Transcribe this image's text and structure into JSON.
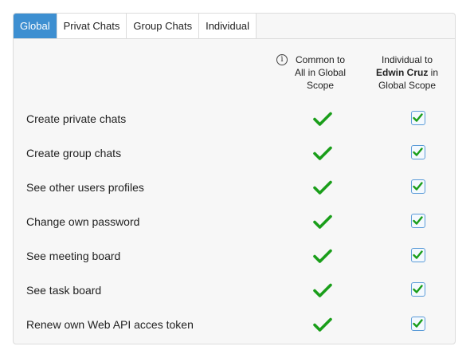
{
  "tabs": [
    {
      "label": "Global",
      "active": true
    },
    {
      "label": "Privat Chats",
      "active": false
    },
    {
      "label": "Group Chats",
      "active": false
    },
    {
      "label": "Individual",
      "active": false
    }
  ],
  "columns": {
    "common_line1": "Common to",
    "common_line2": "All in Global",
    "common_line3": "Scope",
    "indiv_prefix": "Individual to",
    "indiv_user": "Edwin Cruz",
    "indiv_in": "in",
    "indiv_suffix": "Global Scope"
  },
  "info_icon": "info-circle-icon",
  "colors": {
    "accent": "#3d8fd1",
    "check": "#1a9e1a",
    "checkbox_border": "#5a9bd8"
  },
  "permissions": [
    {
      "label": "Create private chats",
      "common": true,
      "individual": true
    },
    {
      "label": "Create group chats",
      "common": true,
      "individual": true
    },
    {
      "label": "See other users profiles",
      "common": true,
      "individual": true
    },
    {
      "label": "Change own password",
      "common": true,
      "individual": true
    },
    {
      "label": "See meeting board",
      "common": true,
      "individual": true
    },
    {
      "label": "See task board",
      "common": true,
      "individual": true
    },
    {
      "label": "Renew own Web API acces token",
      "common": true,
      "individual": true
    }
  ]
}
